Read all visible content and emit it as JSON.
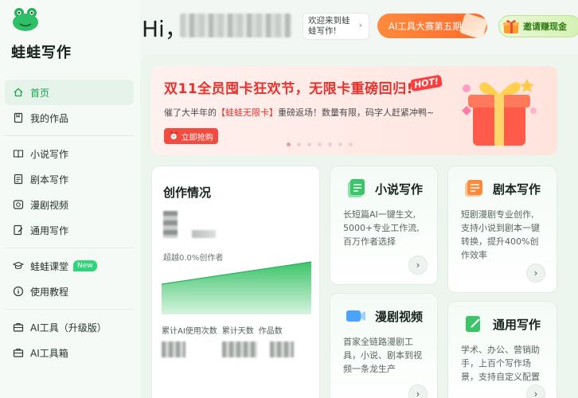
{
  "brand": {
    "name": "蛙蛙写作"
  },
  "sidebar": {
    "items": [
      {
        "label": "首页",
        "icon": "home-icon",
        "active": true
      },
      {
        "label": "我的作品",
        "icon": "bookmark-icon"
      },
      {
        "label": "小说写作",
        "icon": "book-icon"
      },
      {
        "label": "剧本写作",
        "icon": "script-icon"
      },
      {
        "label": "漫剧视频",
        "icon": "video-icon"
      },
      {
        "label": "通用写作",
        "icon": "edit-icon"
      },
      {
        "label": "蛙蛙课堂",
        "icon": "graduation-cap-icon",
        "badge": "New"
      },
      {
        "label": "使用教程",
        "icon": "info-icon"
      },
      {
        "label": "AI工具（升级版）",
        "icon": "toolbox-icon"
      },
      {
        "label": "AI工具箱",
        "icon": "toolbox-icon"
      }
    ]
  },
  "header": {
    "greeting": "Hi，",
    "welcome_line1": "欢迎来到蛙",
    "welcome_line2": "蛙写作!",
    "contest_label": "AI工具大赛第五期",
    "invite_label": "邀请赚现金"
  },
  "banner": {
    "title": "双11全员囤卡狂欢节，无限卡重磅回归!",
    "hot": "HOT!",
    "sub_prefix": "催了大半年的",
    "sub_highlight": "【蛙蛙无限卡】",
    "sub_suffix": "重磅返场！数量有限，码字人赶紧冲鸭~",
    "button_label": "立即抢购"
  },
  "stats": {
    "title": "创作情况",
    "rank_text": "超越0.0%创作者",
    "labels": [
      "累计AI使用次数",
      "累计天数",
      "作品数"
    ]
  },
  "features": [
    {
      "title": "小说写作",
      "desc": [
        "长短篇AI一键生文,",
        "5000+专业工作流,",
        "百万作者选择"
      ]
    },
    {
      "title": "剧本写作",
      "desc": [
        "短剧漫剧专业创作,",
        "支持小说到剧本一键",
        "转换，提升400%创",
        "作效率"
      ]
    },
    {
      "title": "漫剧视频",
      "desc": [
        "首家全链路漫剧工",
        "具，小说、剧本到视",
        "频一条龙生产"
      ]
    },
    {
      "title": "通用写作",
      "desc": [
        "学术、办公、营销助",
        "手，上百个写作场",
        "景，支持自定义配置"
      ]
    }
  ],
  "colors": {
    "accent": "#17a34a",
    "banner_red": "#e8312c",
    "contest_orange": "#ff7a33"
  }
}
